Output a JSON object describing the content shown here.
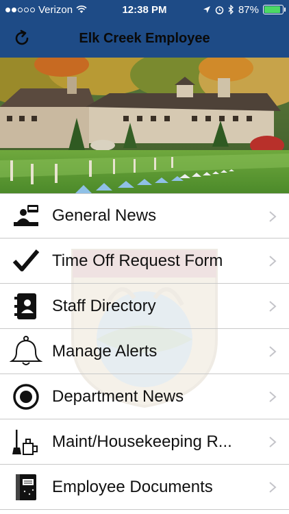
{
  "status": {
    "carrier": "Verizon",
    "time": "12:38 PM",
    "battery_percent": "87%",
    "battery_level": 0.87,
    "signal_bars": 2,
    "battery_color": "#4cd964"
  },
  "header": {
    "title": "Elk Creek Employee",
    "refresh_icon": "refresh-icon",
    "bar_color": "#1e4b86"
  },
  "menu": {
    "items": [
      {
        "label": "General News",
        "icon": "news-icon"
      },
      {
        "label": "Time Off Request Form",
        "icon": "checkmark-icon"
      },
      {
        "label": "Staff Directory",
        "icon": "contacts-book-icon"
      },
      {
        "label": "Manage Alerts",
        "icon": "bell-icon"
      },
      {
        "label": "Department News",
        "icon": "radio-dot-icon"
      },
      {
        "label": "Maint/Housekeeping R...",
        "icon": "cleaning-supplies-icon"
      },
      {
        "label": "Employee Documents",
        "icon": "notebook-icon"
      }
    ]
  }
}
